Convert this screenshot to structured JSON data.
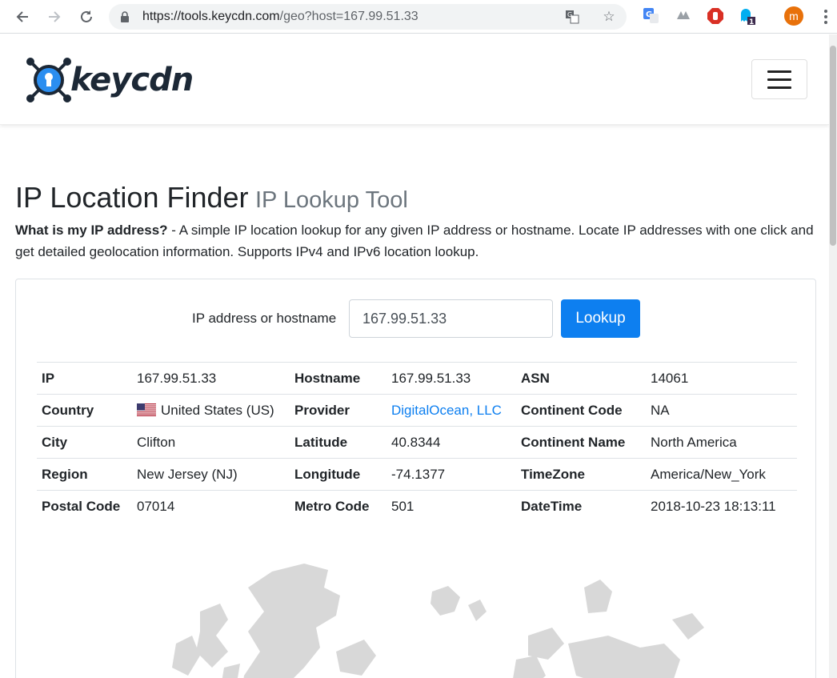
{
  "browser": {
    "url_main": "https://tools.keycdn.com",
    "url_path": "/geo?host=167.99.51.33",
    "avatar_letter": "m",
    "extension_badge": "1"
  },
  "site": {
    "logo_text": "keycdn"
  },
  "page": {
    "title": "IP Location Finder",
    "subtitle": "IP Lookup Tool",
    "intro_bold": "What is my IP address?",
    "intro_text": " - A simple IP location lookup for any given IP address or hostname. Locate IP addresses with one click and get detailed geolocation information. Supports IPv4 and IPv6 location lookup."
  },
  "form": {
    "label": "IP address or hostname",
    "value": "167.99.51.33",
    "button_label": "Lookup"
  },
  "results": {
    "ip_label": "IP",
    "ip": "167.99.51.33",
    "hostname_label": "Hostname",
    "hostname": "167.99.51.33",
    "asn_label": "ASN",
    "asn": "14061",
    "country_label": "Country",
    "country": "United States (US)",
    "provider_label": "Provider",
    "provider": "DigitalOcean, LLC",
    "continent_code_label": "Continent Code",
    "continent_code": "NA",
    "city_label": "City",
    "city": "Clifton",
    "latitude_label": "Latitude",
    "latitude": "40.8344",
    "continent_name_label": "Continent Name",
    "continent_name": "North America",
    "region_label": "Region",
    "region": "New Jersey (NJ)",
    "longitude_label": "Longitude",
    "longitude": "-74.1377",
    "timezone_label": "TimeZone",
    "timezone": "America/New_York",
    "postal_label": "Postal Code",
    "postal": "07014",
    "metro_label": "Metro Code",
    "metro": "501",
    "datetime_label": "DateTime",
    "datetime": "2018-10-23 18:13:11"
  },
  "colors": {
    "accent": "#0d7ff0",
    "logo_dark": "#1c2836",
    "map_land": "#d8d8d8"
  }
}
